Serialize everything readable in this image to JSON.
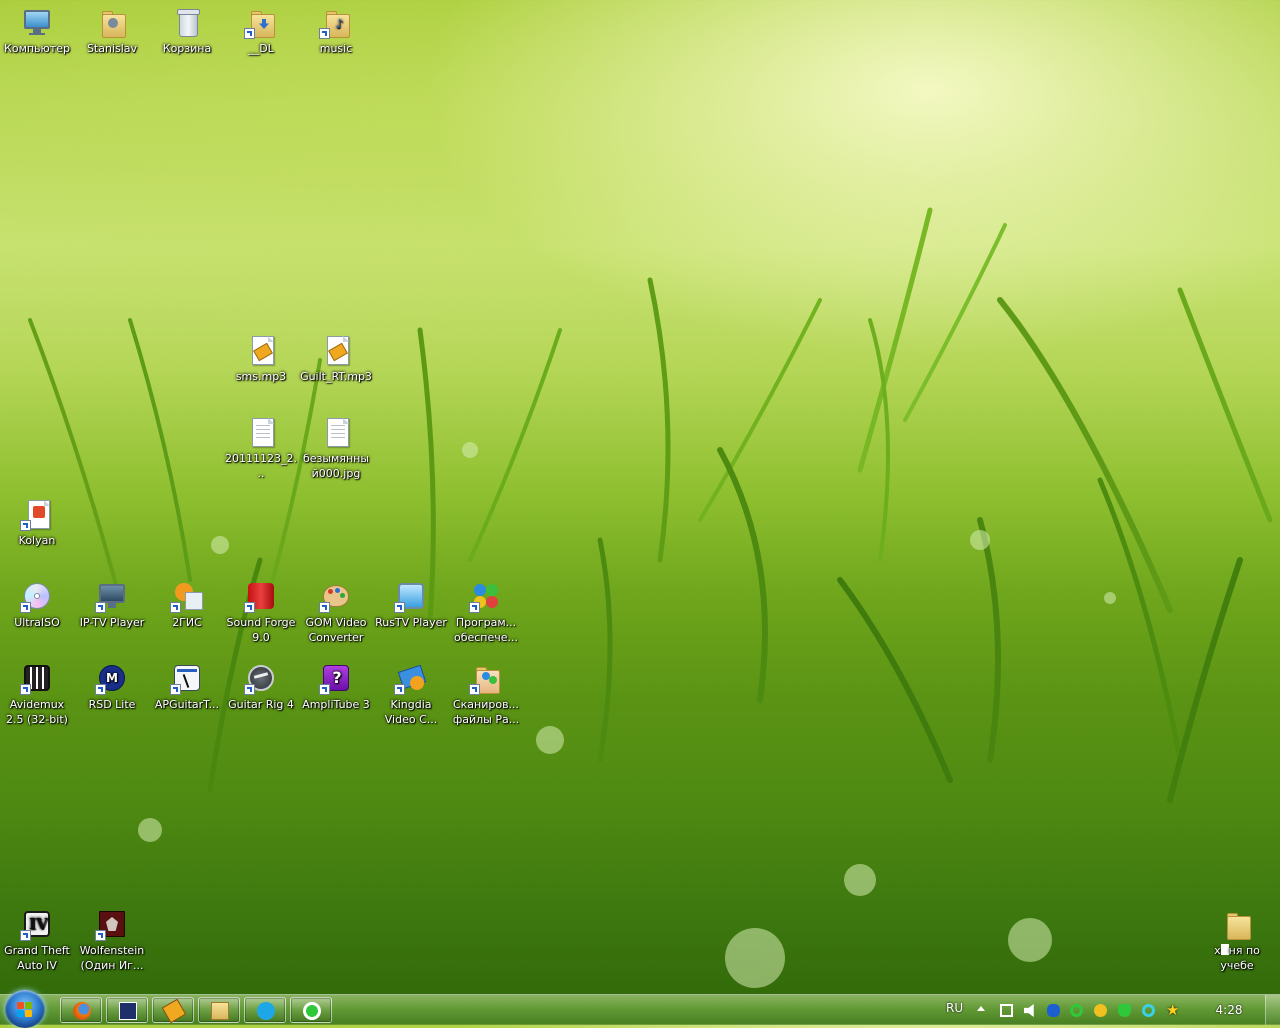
{
  "desktop": {
    "icons": {
      "computer": "Компьютер",
      "stanislav": "Stanislav",
      "recycle_bin": "Корзина",
      "dl": "__DL",
      "music": "music",
      "sms_mp3": "sms.mp3",
      "guilt_mp3": "Guilt_RT.mp3",
      "scan_2011": "20111123_2...",
      "untitled_jpg": "безымянный000.jpg",
      "kolyan": "Kolyan",
      "ultraiso": "UltraISO",
      "iptv_player": "IP-TV Player",
      "twogis": "2ГИС",
      "sound_forge": "Sound Forge 9.0",
      "gom_converter": "GOM Video Converter",
      "rustv_player": "RusTV Player",
      "software": "Програм... обеспече...",
      "avidemux": "Avidemux 2.5 (32-bit)",
      "rsd_lite": "RSD Lite",
      "apguitar": "APGuitarT...",
      "guitar_rig": "Guitar Rig 4",
      "amplitube": "AmpliTube 3",
      "kingdia": "Kingdia Video C...",
      "scanned_files": "Сканиров... файлы Ра...",
      "gta": "Grand Theft Auto IV",
      "wolfenstein": "Wolfenstein (Один Иг...",
      "study_folder_prefix": "х",
      "study_folder_suffix": "ня по учебе"
    }
  },
  "taskbar": {
    "pinned": [
      "firefox-icon",
      "jump-icon",
      "foobar-icon",
      "explorer-icon",
      "skype-icon",
      "icq-icon"
    ],
    "tray": {
      "language": "RU",
      "clock": "4:28",
      "icons": [
        "network-icon",
        "volume-icon",
        "bluetooth-icon",
        "mail-agent-icon",
        "user-status-icon",
        "shield-icon",
        "messenger-icon",
        "favorites-star-icon"
      ]
    }
  },
  "colors": {
    "accent_shortcut": "#1f5fc8",
    "windows_orb": "#2f7fd0"
  }
}
